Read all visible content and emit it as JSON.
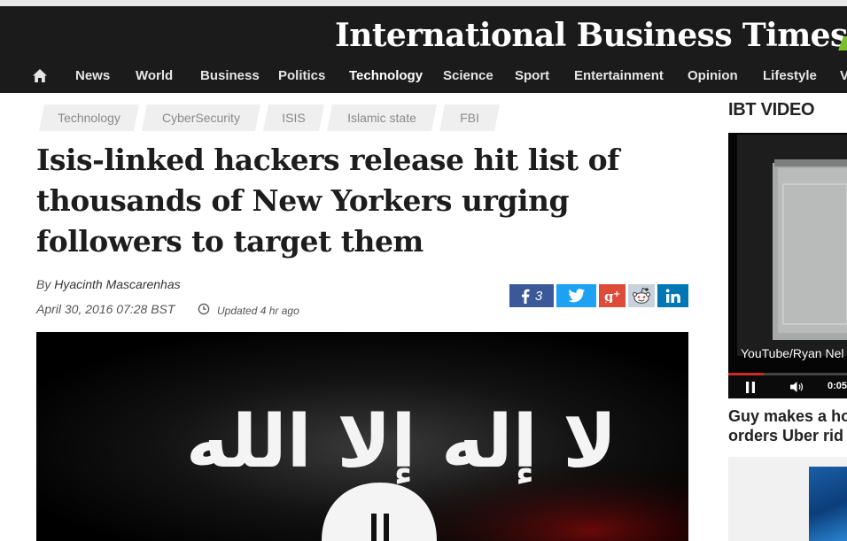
{
  "site": {
    "name": "International Business Times"
  },
  "nav": {
    "items": [
      {
        "label": "News"
      },
      {
        "label": "World"
      },
      {
        "label": "Business"
      },
      {
        "label": "Politics"
      },
      {
        "label": "Technology",
        "active": true
      },
      {
        "label": "Science"
      },
      {
        "label": "Sport"
      },
      {
        "label": "Entertainment"
      },
      {
        "label": "Opinion"
      },
      {
        "label": "Lifestyle"
      },
      {
        "label": "V"
      }
    ]
  },
  "tags": [
    "Technology",
    "CyberSecurity",
    "ISIS",
    "Islamic state",
    "FBI"
  ],
  "article": {
    "headline": "Isis-linked hackers release hit list of thousands of New Yorkers urging followers to target them",
    "byline_prefix": "By",
    "author": "Hyacinth Mascarenhas",
    "date": "April 30, 2016 07:28 BST",
    "updated": "Updated 4 hr ago"
  },
  "share": {
    "facebook_count": "3",
    "icons": [
      "facebook-icon",
      "twitter-icon",
      "google-plus-icon",
      "reddit-icon",
      "linkedin-icon"
    ]
  },
  "hero_image": {
    "text": "لا إله إلا الله"
  },
  "sidebar": {
    "title": "IBT VIDEO",
    "video": {
      "caption": "YouTube/Ryan Nel",
      "time": "0:05",
      "progress": 0.3
    },
    "headline_line1": "Guy makes a ho",
    "headline_line2": "orders Uber rid"
  },
  "colors": {
    "masthead": "#1b1b1b",
    "brand_accent": "#7bbf2a",
    "facebook": "#3b5998",
    "twitter": "#1da1f2",
    "google_plus": "#dd4b39",
    "reddit": "#c9d2dc",
    "linkedin": "#0077b5"
  }
}
